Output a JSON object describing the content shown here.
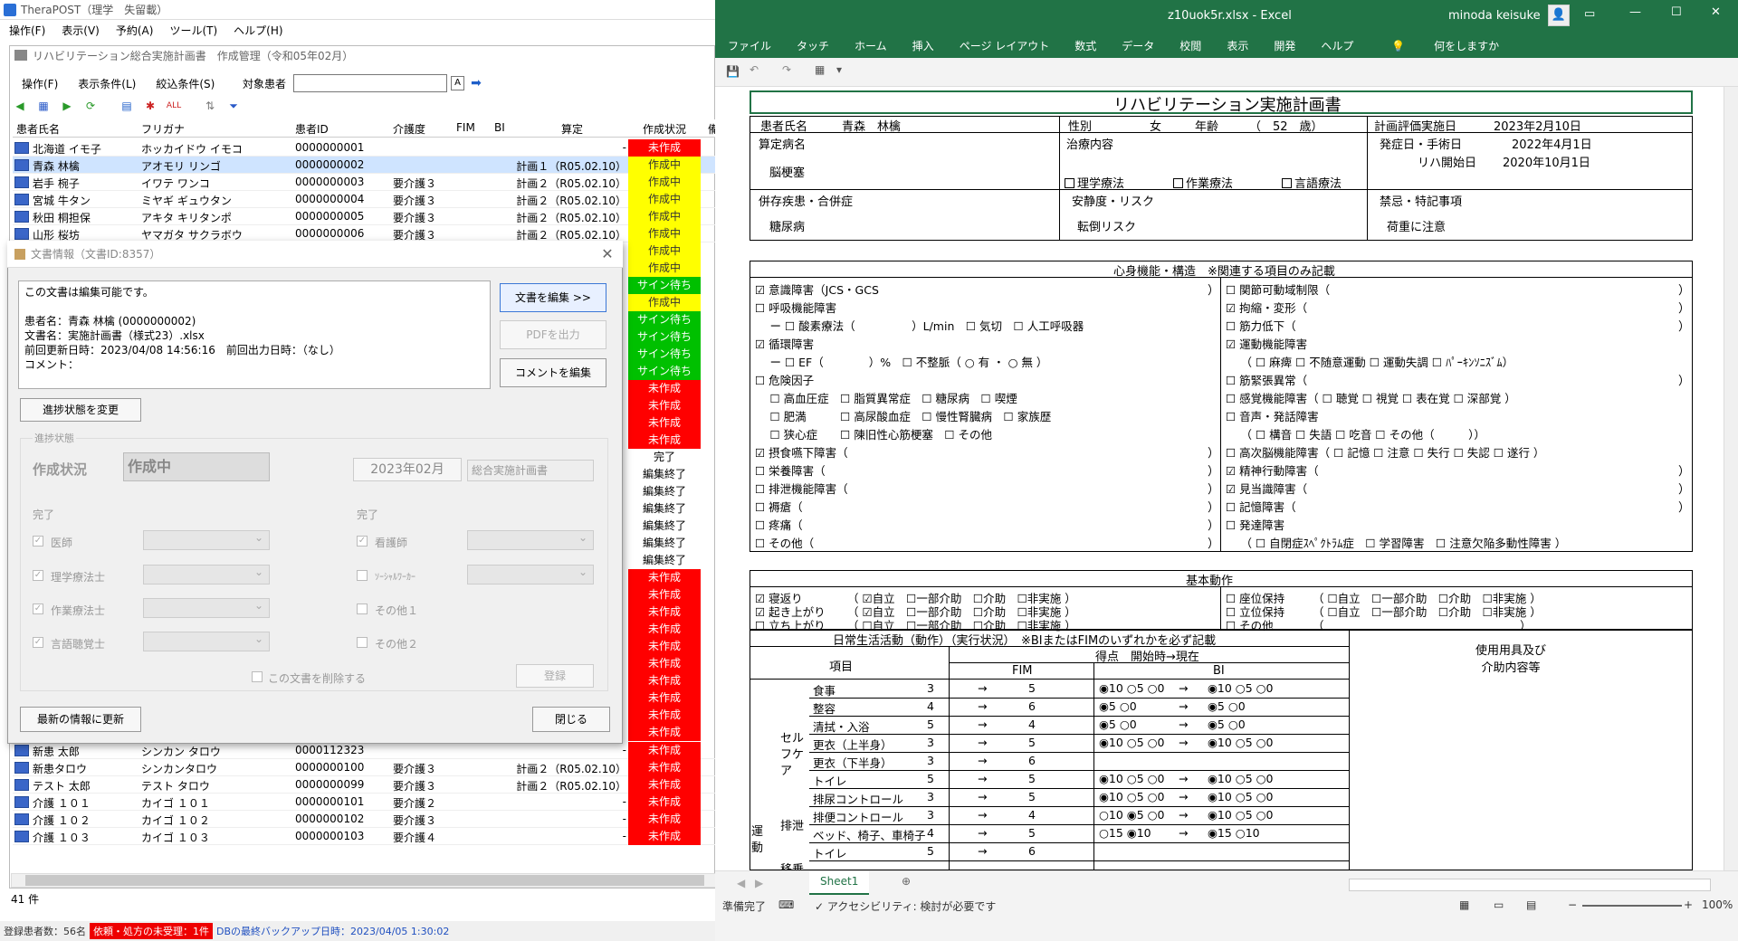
{
  "tp": {
    "title": "TheraPOST（理学　失留載）",
    "menu": [
      "操作(F)",
      "表示(V)",
      "予約(A)",
      "ツール(T)",
      "ヘルプ(H)"
    ],
    "inner_title": "リハビリテーション総合実施計画書　作成管理（令和05年02月）",
    "inner_menu": [
      "操作(F)",
      "表示条件(L)",
      "絞込条件(S)"
    ],
    "target_label": "対象患者",
    "target_a": "A",
    "columns": [
      "患者氏名",
      "フリガナ",
      "患者ID",
      "介護度",
      "FIM",
      "BI",
      "算定",
      "作成状況",
      "備"
    ],
    "rows_top": [
      {
        "name": "北海道 イモ子",
        "kana": "ホッカイドウ イモコ",
        "id": "0000000001",
        "care": "",
        "plan": "-",
        "status": "未作成"
      },
      {
        "name": "青森 林檎",
        "kana": "アオモリ リンゴ",
        "id": "0000000002",
        "care": "",
        "plan": "計画１（R05.02.10）",
        "status": "作成中"
      },
      {
        "name": "岩手 椀子",
        "kana": "イワテ ワンコ",
        "id": "0000000003",
        "care": "要介護３",
        "plan": "計画２（R05.02.10）",
        "status": "作成中"
      },
      {
        "name": "宮城 牛タン",
        "kana": "ミヤギ ギュウタン",
        "id": "0000000004",
        "care": "要介護３",
        "plan": "計画２（R05.02.10）",
        "status": "作成中"
      },
      {
        "name": "秋田 桐担保",
        "kana": "アキタ キリタンポ",
        "id": "0000000005",
        "care": "要介護３",
        "plan": "計画２（R05.02.10）",
        "status": "作成中"
      },
      {
        "name": "山形 桜坊",
        "kana": "ヤマガタ サクラボウ",
        "id": "0000000006",
        "care": "要介護３",
        "plan": "計画２（R05.02.10）",
        "status": "作成中"
      }
    ],
    "status_col": [
      "作成中",
      "作成中",
      "サイン待ち",
      "作成中",
      "サイン待ち",
      "サイン待ち",
      "サイン待ち",
      "サイン待ち",
      "未作成",
      "未作成",
      "未作成",
      "未作成",
      "完了",
      "編集終了",
      "編集終了",
      "編集終了",
      "編集終了",
      "編集終了",
      "編集終了",
      "未作成",
      "未作成",
      "未作成",
      "未作成",
      "未作成",
      "未作成",
      "未作成",
      "未作成",
      "未作成",
      "未作成"
    ],
    "rows_bottom": [
      {
        "name": "新患 太郎",
        "kana": "シンカン タロウ",
        "id": "0000112323",
        "care": "",
        "plan": "-",
        "status": "未作成"
      },
      {
        "name": "新患タロウ",
        "kana": "シンカンタロウ",
        "id": "0000000100",
        "care": "要介護３",
        "plan": "計画２（R05.02.10）",
        "status": "未作成"
      },
      {
        "name": "テスト 太郎",
        "kana": "テスト タロウ",
        "id": "0000000099",
        "care": "要介護３",
        "plan": "計画２（R05.02.10）",
        "status": "未作成"
      },
      {
        "name": "介護 １０１",
        "kana": "カイゴ １０１",
        "id": "0000000101",
        "care": "要介護２",
        "plan": "-",
        "status": "未作成"
      },
      {
        "name": "介護 １０２",
        "kana": "カイゴ １０２",
        "id": "0000000102",
        "care": "要介護３",
        "plan": "-",
        "status": "未作成"
      },
      {
        "name": "介護 １０３",
        "kana": "カイゴ １０３",
        "id": "0000000103",
        "care": "要介護４",
        "plan": "-",
        "status": "未作成"
      }
    ],
    "count": "41 件",
    "status_bar": {
      "registered": "登録患者数：56名",
      "alert": "依頼・処方の未受理：1件",
      "backup": "DBの最終バックアップ日時：2023/04/05 1:30:02"
    }
  },
  "dlg": {
    "title": "文書情報（文書ID:8357）",
    "msg_lines": [
      "この文書は編集可能です。",
      "",
      "患者名：青森 林檎 (0000000002)",
      "文書名：実施計画書（様式23）.xlsx",
      "前回更新日時：2023/04/08 14:56:16　前回出力日時：（なし）",
      "コメント："
    ],
    "btn_edit": "文書を編集 >>",
    "btn_pdf": "PDFを出力",
    "btn_comment": "コメントを編集",
    "btn_progress": "進捗状態を変更",
    "grp_label": "進捗状態",
    "sit_label": "作成状況",
    "sit_value": "作成中",
    "ym_value": "2023年02月",
    "kind_value": "総合実施計画書",
    "done_left": "完了",
    "done_right": "完了",
    "roles_left": [
      "医師",
      "理学療法士",
      "作業療法士",
      "言語聴覚士"
    ],
    "roles_right": [
      "看護師",
      "ｿｰｼｬﾙﾜｰｶｰ",
      "その他１",
      "その他２"
    ],
    "delete_label": "この文書を削除する",
    "btn_register": "登録",
    "btn_refresh": "最新の情報に更新",
    "btn_close": "閉じる"
  },
  "xl": {
    "title": "z10uok5r.xlsx  -  Excel",
    "user": "minoda keisuke",
    "ribbon": [
      "ファイル",
      "タッチ",
      "ホーム",
      "挿入",
      "ページ レイアウト",
      "数式",
      "データ",
      "校閲",
      "表示",
      "開発",
      "ヘルプ",
      "何をしますか"
    ],
    "sheet_tab": "Sheet1",
    "status_ready": "準備完了",
    "status_access": "アクセシビリティ: 検討が必要です",
    "zoom": "100%",
    "form": {
      "title": "リハビリテーション実施計画書",
      "patient_label": "患者氏名",
      "patient": "青森　林檎",
      "sex_label": "性別",
      "sex": "女",
      "age_label": "年齢",
      "age": "（　52　歳）",
      "eval_label": "計画評価実施日",
      "eval_date": "2023年2月10日",
      "disease_label": "算定病名",
      "disease": "脳梗塞",
      "treat_label": "治療内容",
      "treat": [
        "理学療法",
        "作業療法",
        "言語療法"
      ],
      "onset_label": "発症日・手術日",
      "onset": "2022年4月1日",
      "rehab_label": "リハ開始日",
      "rehab": "2020年10月1日",
      "comorb_label": "併存疾患・合併症",
      "comorb": "糖尿病",
      "risk_label": "安静度・リスク",
      "risk": "転倒リスク",
      "prohib_label": "禁忌・特記事項",
      "prohib": "荷重に注意",
      "section1": "心身機能・構造　※関連する項目のみ記載",
      "section2": "基本動作",
      "section3": "日常生活活動（動作）（実行状況）　※BIまたはFIMのいずれかを必ず記載",
      "equip": "使用用具及び\n介助内容等"
    }
  }
}
